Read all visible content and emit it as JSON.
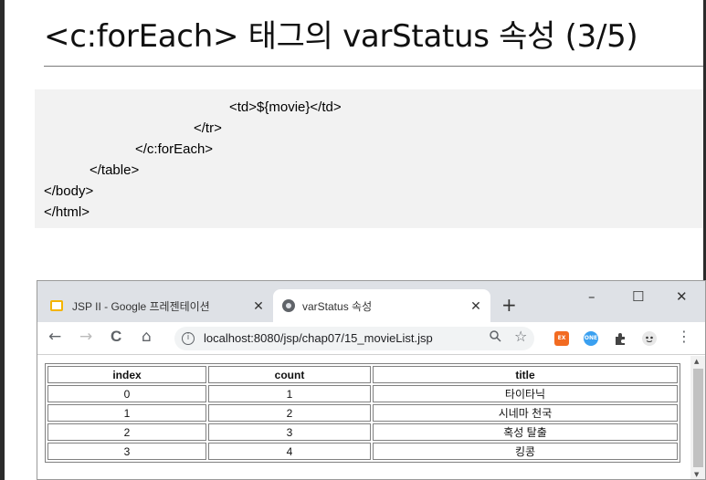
{
  "slide": {
    "title": "<c:forEach> 태그의 varStatus 속성 (3/5)",
    "code_lines": [
      "<td>${movie}</td>",
      "</tr>",
      "</c:forEach>",
      "</table>",
      "</body>",
      "</html>"
    ]
  },
  "browser": {
    "tabs": [
      {
        "label": "JSP II - Google 프레젠테이션",
        "icon": "google-slides-icon",
        "active": false
      },
      {
        "label": "varStatus 속성",
        "icon": "globe-icon",
        "active": true
      }
    ],
    "new_tab_glyph": "+",
    "window_controls": {
      "minimize": "–",
      "maximize": "☐",
      "close": "✕"
    },
    "toolbar": {
      "back": "←",
      "forward": "→",
      "reload": "C",
      "home": "⌂",
      "url": "localhost:8080/jsp/chap07/15_movieList.jsp",
      "zoom_icon": "zoom-icon",
      "bookmark": "☆",
      "ext1_label": "EX",
      "ext2_label": "ONE",
      "menu": "⋮"
    },
    "table": {
      "headers": [
        "index",
        "count",
        "title"
      ],
      "rows": [
        [
          "0",
          "1",
          "타이타닉"
        ],
        [
          "1",
          "2",
          "시네마 천국"
        ],
        [
          "2",
          "3",
          "혹성 탈출"
        ],
        [
          "3",
          "4",
          "킹콩"
        ]
      ]
    },
    "colors": {
      "tabstrip": "#dee1e6",
      "ext1": "#f26b21",
      "ext2": "#3aa0f0"
    }
  }
}
